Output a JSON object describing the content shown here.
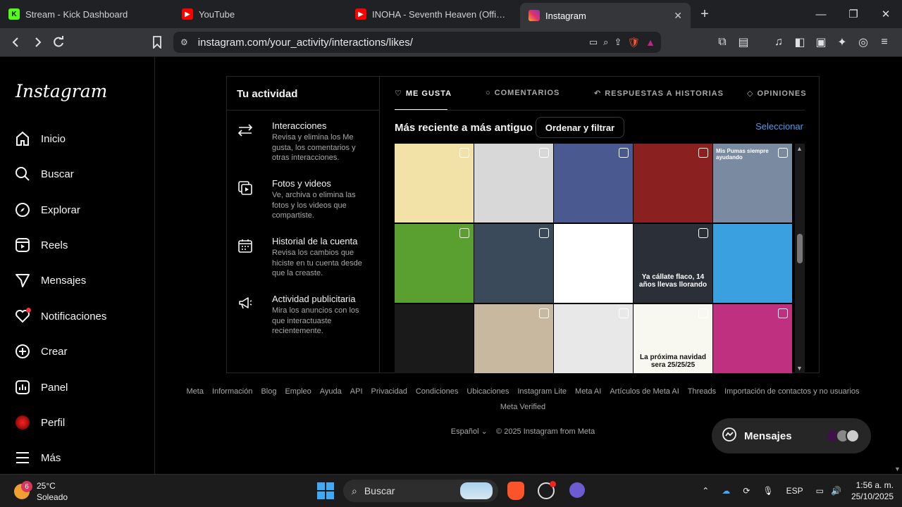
{
  "browser": {
    "tabs": [
      {
        "label": "Stream - Kick Dashboard",
        "icon": "kick-icon",
        "color": "#53fc18"
      },
      {
        "label": "YouTube",
        "icon": "youtube-icon",
        "color": "#ff0000"
      },
      {
        "label": "INOHA - Seventh Heaven (Official To",
        "icon": "youtube-icon",
        "color": "#ff0000"
      },
      {
        "label": "Instagram",
        "icon": "instagram-icon",
        "color": "#e1306c",
        "active": true
      }
    ],
    "new_tab": "+",
    "url": "instagram.com/your_activity/interactions/likes/"
  },
  "sidebar": {
    "logo": "Instagram",
    "items": [
      {
        "label": "Inicio",
        "icon": "home-icon"
      },
      {
        "label": "Buscar",
        "icon": "search-icon"
      },
      {
        "label": "Explorar",
        "icon": "compass-icon"
      },
      {
        "label": "Reels",
        "icon": "reels-icon"
      },
      {
        "label": "Mensajes",
        "icon": "send-icon"
      },
      {
        "label": "Notificaciones",
        "icon": "heart-icon"
      },
      {
        "label": "Crear",
        "icon": "plus-square-icon"
      },
      {
        "label": "Panel",
        "icon": "chart-icon"
      },
      {
        "label": "Perfil",
        "icon": "avatar-icon"
      },
      {
        "label": "Más",
        "icon": "menu-icon"
      }
    ]
  },
  "activity": {
    "title": "Tu actividad",
    "items": [
      {
        "name": "Interacciones",
        "desc": "Revisa y elimina los Me gusta, los comentarios y otras interacciones.",
        "icon": "arrows-icon"
      },
      {
        "name": "Fotos y videos",
        "desc": "Ve, archiva o elimina las fotos y los videos que compartiste.",
        "icon": "media-icon"
      },
      {
        "name": "Historial de la cuenta",
        "desc": "Revisa los cambios que hiciste en tu cuenta desde que la creaste.",
        "icon": "calendar-icon"
      },
      {
        "name": "Actividad publicitaria",
        "desc": "Mira los anuncios con los que interactuaste recientemente.",
        "icon": "megaphone-icon"
      }
    ],
    "tabs": [
      {
        "label": "ME GUSTA",
        "icon": "heart-icon",
        "active": true
      },
      {
        "label": "COMENTARIOS",
        "icon": "comment-icon"
      },
      {
        "label": "RESPUESTAS A HISTORIAS",
        "icon": "reply-icon"
      },
      {
        "label": "OPINIONES",
        "icon": "tag-icon"
      }
    ],
    "sort_label": "Más reciente a más antiguo",
    "filter_button": "Ordenar y filtrar",
    "select_link": "Seleccionar",
    "grid": [
      {
        "bg": "#f2e2a8",
        "caption": "",
        "reel": true
      },
      {
        "bg": "#d8d8d8",
        "caption": "",
        "reel": true
      },
      {
        "bg": "#4a5a90",
        "caption": "",
        "reel": true
      },
      {
        "bg": "#8a2020",
        "caption": "",
        "reel": true
      },
      {
        "bg": "#7a8aa0",
        "caption": "Mis Pumas siempre ayudando",
        "reel": true
      },
      {
        "bg": "#5aa030",
        "caption": "",
        "reel": true
      },
      {
        "bg": "#3a4a5a",
        "caption": "",
        "reel": true
      },
      {
        "bg": "#ffffff",
        "caption": "",
        "reel": false
      },
      {
        "bg": "#2a2f38",
        "caption": "Ya cállate flaco, 14 años llevas llorando",
        "reel": true
      },
      {
        "bg": "#3aa0e0",
        "caption": "",
        "reel": false
      },
      {
        "bg": "#1a1a1a",
        "caption": "",
        "reel": false
      },
      {
        "bg": "#c8b8a0",
        "caption": "",
        "reel": true
      },
      {
        "bg": "#e8e8e8",
        "caption": "",
        "reel": true
      },
      {
        "bg": "#f8f8f0",
        "caption": "La próxima navidad sera 25/25/25",
        "reel": true
      },
      {
        "bg": "#c03080",
        "caption": "",
        "reel": true
      }
    ]
  },
  "footer": {
    "links": [
      "Meta",
      "Información",
      "Blog",
      "Empleo",
      "Ayuda",
      "API",
      "Privacidad",
      "Condiciones",
      "Ubicaciones",
      "Instagram Lite",
      "Meta AI",
      "Artículos de Meta AI",
      "Threads",
      "Importación de contactos y no usuarios"
    ],
    "row2": "Meta Verified",
    "language": "Español",
    "copyright": "© 2025 Instagram from Meta"
  },
  "messages_pill": {
    "label": "Mensajes"
  },
  "taskbar": {
    "weather_badge": "6",
    "temperature": "25°C",
    "condition": "Soleado",
    "search_placeholder": "Buscar",
    "language": "ESP",
    "time": "1:56 a. m.",
    "date": "25/10/2025"
  }
}
